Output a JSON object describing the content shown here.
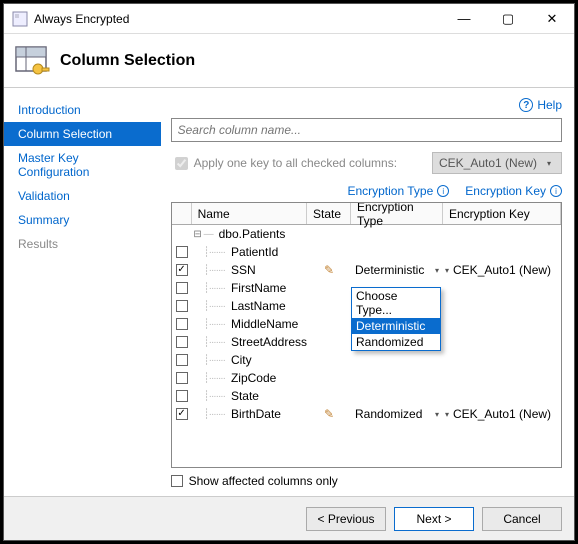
{
  "window": {
    "title": "Always Encrypted",
    "header": "Column Selection"
  },
  "help": {
    "label": "Help"
  },
  "sidebar": {
    "items": [
      {
        "label": "Introduction",
        "selected": false,
        "disabled": false
      },
      {
        "label": "Column Selection",
        "selected": true,
        "disabled": false
      },
      {
        "label": "Master Key Configuration",
        "selected": false,
        "disabled": false
      },
      {
        "label": "Validation",
        "selected": false,
        "disabled": false
      },
      {
        "label": "Summary",
        "selected": false,
        "disabled": false
      },
      {
        "label": "Results",
        "selected": false,
        "disabled": true
      }
    ]
  },
  "search": {
    "placeholder": "Search column name..."
  },
  "apply": {
    "label": "Apply one key to all checked columns:",
    "checked": true,
    "cek_value": "CEK_Auto1 (New)"
  },
  "legend": {
    "type_label": "Encryption Type",
    "key_label": "Encryption Key"
  },
  "grid": {
    "headers": {
      "name": "Name",
      "state": "State",
      "type": "Encryption Type",
      "key": "Encryption Key"
    },
    "root": "dbo.Patients",
    "rows": [
      {
        "col": "PatientId",
        "checked": false,
        "state": "",
        "type": "",
        "key": ""
      },
      {
        "col": "SSN",
        "checked": true,
        "state": "edit",
        "type": "Deterministic",
        "key": "CEK_Auto1 (New)"
      },
      {
        "col": "FirstName",
        "checked": false,
        "state": "",
        "type": "dropdown",
        "key": ""
      },
      {
        "col": "LastName",
        "checked": false,
        "state": "",
        "type": "",
        "key": ""
      },
      {
        "col": "MiddleName",
        "checked": false,
        "state": "",
        "type": "",
        "key": ""
      },
      {
        "col": "StreetAddress",
        "checked": false,
        "state": "",
        "type": "",
        "key": ""
      },
      {
        "col": "City",
        "checked": false,
        "state": "",
        "type": "",
        "key": ""
      },
      {
        "col": "ZipCode",
        "checked": false,
        "state": "",
        "type": "",
        "key": ""
      },
      {
        "col": "State",
        "checked": false,
        "state": "",
        "type": "",
        "key": ""
      },
      {
        "col": "BirthDate",
        "checked": true,
        "state": "edit",
        "type": "Randomized",
        "key": "CEK_Auto1 (New)"
      }
    ],
    "dropdown": {
      "items": [
        "Choose Type...",
        "Deterministic",
        "Randomized"
      ],
      "highlighted": 1
    }
  },
  "footer_check": {
    "label": "Show affected columns only",
    "checked": false
  },
  "buttons": {
    "previous": "< Previous",
    "next": "Next >",
    "cancel": "Cancel"
  }
}
